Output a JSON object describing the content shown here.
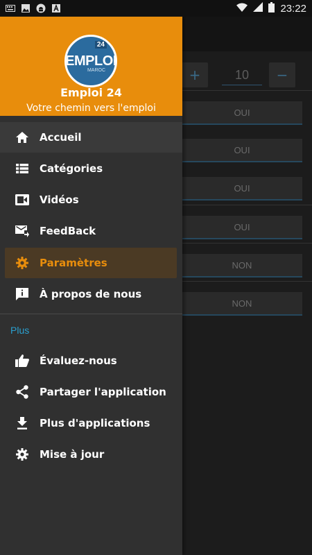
{
  "status_bar": {
    "time": "23:22",
    "left_icons": [
      "keyboard-icon",
      "image-icon",
      "android-icon",
      "text-icon"
    ],
    "right_icons": [
      "wifi-icon",
      "signal-icon",
      "battery-icon"
    ]
  },
  "drawer": {
    "header": {
      "logo_badge": "24",
      "logo_text": "EMPLOI",
      "logo_subtext": "MAROC",
      "app_name": "Emploi 24",
      "tagline": "Votre chemin vers l'emploi",
      "bg_color": "#e88d0c"
    },
    "items": [
      {
        "label": "Accueil",
        "icon": "home-icon"
      },
      {
        "label": "Catégories",
        "icon": "list-icon"
      },
      {
        "label": "Vidéos",
        "icon": "video-icon"
      },
      {
        "label": "FeedBack",
        "icon": "mail-send-icon"
      },
      {
        "label": "Paramètres",
        "icon": "gear-icon",
        "active": true
      },
      {
        "label": "À propos de nous",
        "icon": "info-chat-icon"
      }
    ],
    "section_title": "Plus",
    "more_items": [
      {
        "label": "Évaluez-nous",
        "icon": "thumbs-up-icon"
      },
      {
        "label": "Partager l'application",
        "icon": "share-icon"
      },
      {
        "label": "Plus d'applications",
        "icon": "download-icon"
      },
      {
        "label": "Mise à jour",
        "icon": "gear-icon"
      }
    ]
  },
  "background": {
    "stepper": {
      "plus": "+",
      "value": "10",
      "minus": "−"
    },
    "rows": [
      "OUI",
      "OUI",
      "OUI",
      "OUI",
      "NON",
      "NON"
    ]
  },
  "colors": {
    "accent": "#e88d0c",
    "section": "#2aa0d0"
  }
}
